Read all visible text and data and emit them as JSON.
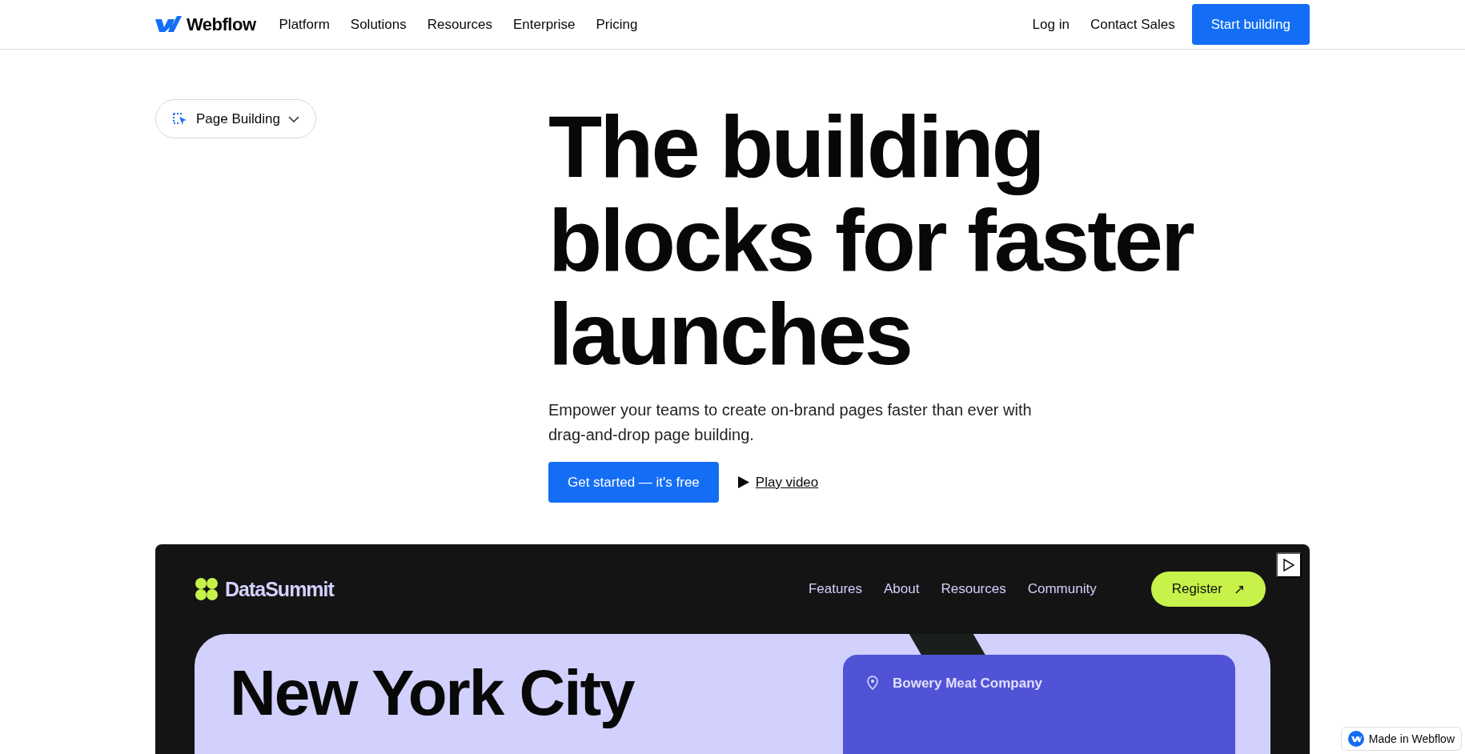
{
  "nav": {
    "brand": "Webflow",
    "links": [
      "Platform",
      "Solutions",
      "Resources",
      "Enterprise",
      "Pricing"
    ],
    "login": "Log in",
    "contact": "Contact Sales",
    "cta": "Start building"
  },
  "hero": {
    "category": "Page Building",
    "heading": "The building blocks for faster launches",
    "subtitle": "Empower your teams to create on-brand pages faster than ever with drag-and-drop page building.",
    "primary": "Get started — it's free",
    "video": "Play video"
  },
  "demo": {
    "brand": "DataSummit",
    "links": [
      "Features",
      "About",
      "Resources",
      "Community"
    ],
    "register": "Register",
    "register_arrow": "↗",
    "city": "New York City",
    "venue": "Bowery Meat Company"
  },
  "badge": "Made in Webflow"
}
